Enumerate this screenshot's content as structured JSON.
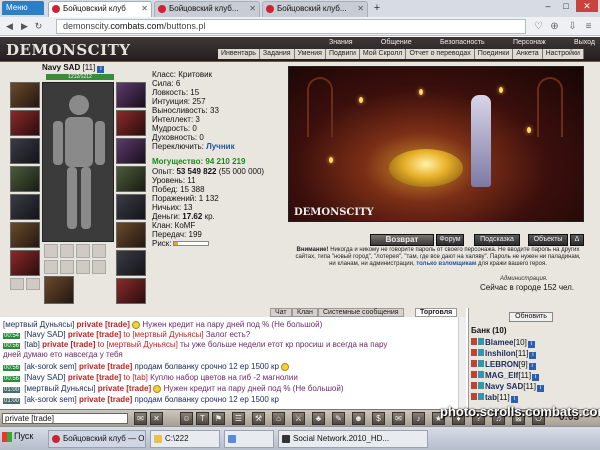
{
  "browser": {
    "menu_label": "Меню",
    "tabs": [
      {
        "label": "Бойцовский клуб"
      },
      {
        "label": "Бойцовский клуб..."
      },
      {
        "label": "Бойцовский клуб..."
      }
    ],
    "new_tab": "+",
    "url_host": "demonscity.",
    "url_domain": "combats.com",
    "url_path": "/buttons.pl"
  },
  "game_nav": {
    "logo": "DEMONSCITY",
    "top_menu": [
      "Знания",
      "Общение",
      "Безопасность",
      "Персонаж",
      "Выход"
    ],
    "sub_menu": [
      "Инвентарь",
      "Задания",
      "Умения",
      "Подвиги",
      "Мой Скролл",
      "Отчет о переводах",
      "Поединки",
      "Анкета",
      "Настройки"
    ]
  },
  "character": {
    "name": "Navy SAD",
    "level": "[11]",
    "hp": "1212/1212",
    "stats": [
      {
        "label": "Класс:",
        "value": "Критовик"
      },
      {
        "label": "Сила:",
        "value": "6"
      },
      {
        "label": "Ловкость:",
        "value": "15"
      },
      {
        "label": "Интуиция:",
        "value": "257"
      },
      {
        "label": "Выносливость:",
        "value": "33"
      },
      {
        "label": "Интеллект:",
        "value": "3"
      },
      {
        "label": "Мудрость:",
        "value": "0"
      },
      {
        "label": "Духовность:",
        "value": "0"
      },
      {
        "label": "Переключить:",
        "value": "Лучник"
      }
    ],
    "might_label": "Могущество:",
    "might_value": "94 210 219",
    "exp_label": "Опыт:",
    "exp_value": "53 549 822",
    "exp_next": "(55 000 000)",
    "details": [
      {
        "label": "Уровень:",
        "value": "11"
      },
      {
        "label": "Побед:",
        "value": "15 388"
      },
      {
        "label": "Поражений:",
        "value": "1 132"
      },
      {
        "label": "Ничьих:",
        "value": "13"
      }
    ],
    "money_label": "Деньги:",
    "money_value": "17.62",
    "money_unit": "кр.",
    "clan_label": "Клан:",
    "clan_value": "КоМF",
    "transfers_label": "Передач:",
    "transfers_value": "199",
    "risk_label": "Риск:",
    "risk_fraction": 0.12
  },
  "scene": {
    "logo": "DEMONSCITY",
    "buttons": [
      "Возврат",
      "Форум",
      "Подсказка",
      "Объекты",
      "Δ"
    ]
  },
  "warning": {
    "bold": "Внимание!",
    "text": "Никогда и никому не говорите пароль от своего персонажа. Не вводите пароль на других сайтах, типа \"новый город\", \"лотерея\", \"там, где все дают на халяву\". Пароль не нужен ни паладинам, ни кланам, ни администрации,",
    "link": "только взломщикам",
    "tail": "для кражи вашего героя.",
    "admin": "Администрация.",
    "online": "Сейчас в городе 152 чел."
  },
  "chat": {
    "tabs": [
      "Чат",
      "Клан",
      "Системные сообщения",
      "Торговля"
    ],
    "lines": [
      {
        "time": "",
        "user": "[мертвый Дуньясы]",
        "tag": "private [trade]",
        "target": "",
        "msg": "Нужен кредит на пару дней под % (Не большой)",
        "style": "g"
      },
      {
        "time": "00:54",
        "user": "[Navy SAD]",
        "tag": "private [trade]",
        "target": "to [мертвый Дуньясы]",
        "msg": "Залог есть?",
        "style": "g"
      },
      {
        "time": "00:56",
        "user": "[tab]",
        "tag": "private [trade]",
        "target": "to [мертвый Дуньясы]",
        "msg": "ты уже больше недели етот кр просиш и всегда на пару",
        "style": "g"
      },
      {
        "time": "",
        "user": "",
        "tag": "",
        "target": "",
        "msg": "дней думаю ето навсегда у тебя",
        "style": "g"
      },
      {
        "time": "00:56",
        "user": "[ak-sorok sem]",
        "tag": "private [trade]",
        "target": "",
        "msg": "продам болванку срочно 12 ер 1500 кр",
        "style": "u"
      },
      {
        "time": "00:56",
        "user": "[Navy SAD]",
        "tag": "private [trade]",
        "target": "to [tab]",
        "msg": "Куплю набор цветов на гиб -2 магнолии",
        "style": "g"
      },
      {
        "time": "01:00",
        "user": "[мертвый Дуньясы]",
        "tag": "private [trade]",
        "target": "",
        "msg": "Нужен кредит на пару дней под % (Не большой)",
        "style": "g"
      },
      {
        "time": "01:00",
        "user": "[ak-sorok sem]",
        "tag": "private [trade]",
        "target": "",
        "msg": "продам болванку срочно 12 ер 1500 кр",
        "style": "u"
      }
    ]
  },
  "roster": {
    "refresh_label": "Обновить",
    "title": "Банк (10)",
    "users": [
      {
        "name": "Blamee",
        "level": "[10]"
      },
      {
        "name": "Inshilon",
        "level": "[11]"
      },
      {
        "name": "LEBRON",
        "level": "[9]"
      },
      {
        "name": "MAG_Elf",
        "level": "[11]"
      },
      {
        "name": "Navy SAD",
        "level": "[11]"
      },
      {
        "name": "tab",
        "level": "[11]"
      }
    ]
  },
  "input": {
    "value": "private [trade]",
    "clock": "0:03"
  },
  "taskbar": {
    "start": "Пуск",
    "tasks": [
      "Бойцовский клуб — O...",
      "C:\\222",
      "",
      "Social Network.2010_HD..."
    ]
  },
  "watermark": "photo.scrolls.combats.com",
  "colors": {
    "nav_bg": "#2b2424",
    "accent_green": "#1a8a1a",
    "private_red": "#c02222",
    "link_blue": "#22559a"
  }
}
